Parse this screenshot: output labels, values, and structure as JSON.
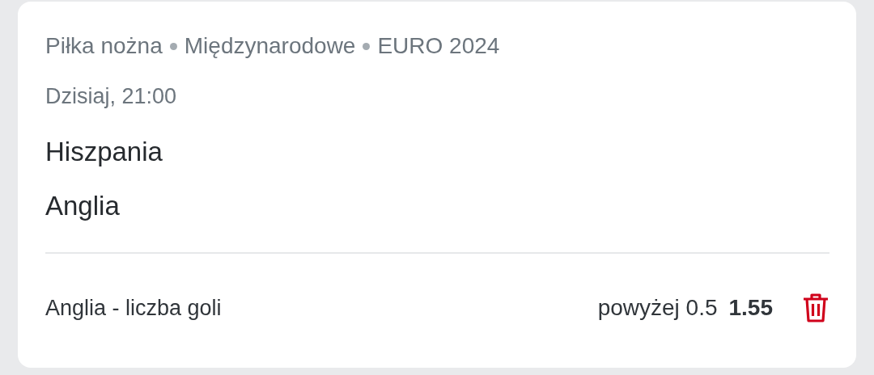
{
  "breadcrumb": [
    "Piłka nożna",
    "Międzynarodowe",
    "EURO 2024"
  ],
  "time": "Dzisiaj, 21:00",
  "teams": [
    "Hiszpania",
    "Anglia"
  ],
  "bet": {
    "market": "Anglia - liczba goli",
    "selection": "powyżej 0.5",
    "odds": "1.55"
  }
}
